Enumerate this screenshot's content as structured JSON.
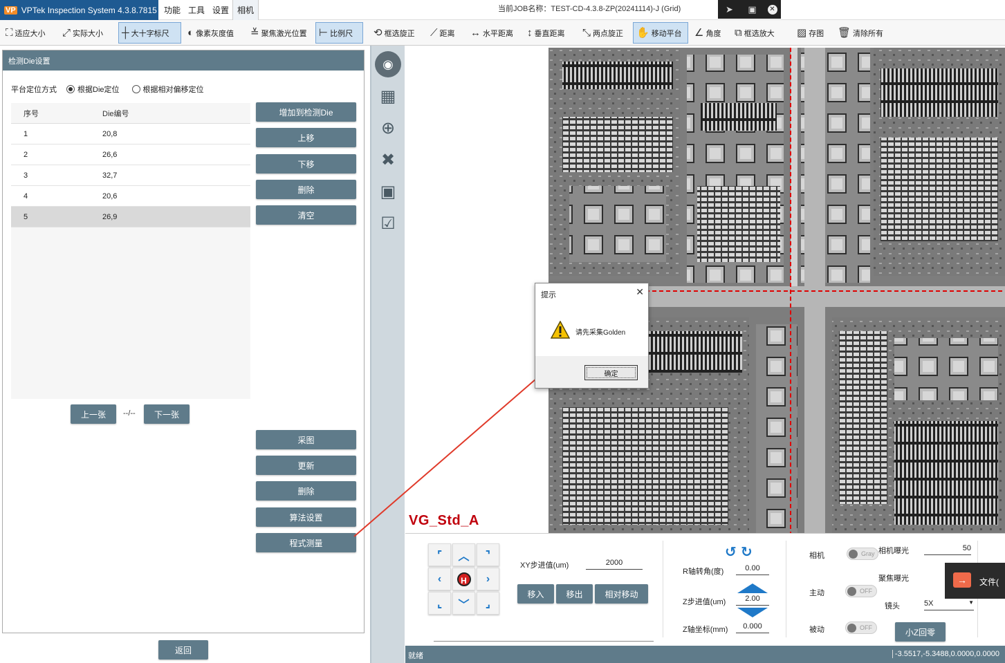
{
  "titlebar": {
    "app_title": "VPTek Inspection System 4.3.8.7815",
    "logo_text": "VP",
    "menu": [
      "功能",
      "工具",
      "设置",
      "相机"
    ],
    "job_name": "当前JOB名称：TEST-CD-4.3.8-ZP(20241114)-J (Grid)"
  },
  "toolbar": {
    "fit_size": "适应大小",
    "actual_size": "实际大小",
    "cross_ruler": "大十字标尺",
    "pixel_gray": "像素灰度值",
    "focus_laser": "聚焦激光位置",
    "scale_ruler": "比例尺",
    "box_rotate": "框选旋正",
    "distance": "距离",
    "h_distance": "水平距离",
    "v_distance": "垂直距离",
    "two_point_rotate": "两点旋正",
    "move_stage": "移动平台",
    "angle": "角度",
    "box_zoom": "框选放大",
    "save_image": "存图",
    "clear_all": "清除所有"
  },
  "left_panel": {
    "header": "检测Die设置",
    "mode_label": "平台定位方式",
    "mode_option_1": "根据Die定位",
    "mode_option_2": "根据相对偏移定位",
    "table_headers": [
      "序号",
      "Die编号"
    ],
    "rows": [
      {
        "idx": "1",
        "die": "20,8"
      },
      {
        "idx": "2",
        "die": "26,6"
      },
      {
        "idx": "3",
        "die": "32,7"
      },
      {
        "idx": "4",
        "die": "20,6"
      },
      {
        "idx": "5",
        "die": "26,9"
      }
    ],
    "buttons": {
      "add": "增加到检测Die",
      "up": "上移",
      "down": "下移",
      "delete": "删除",
      "clear": "清空",
      "prev": "上一张",
      "next": "下一张",
      "capture": "采图",
      "update": "更新",
      "delete2": "删除",
      "algo": "算法设置",
      "measure": "程式测量"
    },
    "pager": "--/--",
    "return": "返回"
  },
  "viewer": {
    "recipe_name": "VG_Std_A"
  },
  "dialog": {
    "title": "提示",
    "message": "请先采集Golden",
    "ok": "确定"
  },
  "controls": {
    "xy_step_label": "XY步进值(um)",
    "xy_step": "2000",
    "move_in": "移入",
    "move_out": "移出",
    "relative_move": "相对移动",
    "r_angle_label": "R轴转角(度)",
    "r_angle": "0.00",
    "z_step_label": "Z步进值(um)",
    "z_step": "2.00",
    "z_coord_label": "Z轴坐标(mm)",
    "z_coord": "0.000",
    "camera_label": "相机",
    "camera_toggle": "Gray",
    "exposure_label": "相机曝光",
    "exposure": "50",
    "focus_exposure_label": "聚焦曝光",
    "active_label": "主动",
    "active_toggle": "OFF",
    "lens_label": "镜头",
    "lens": "5X",
    "passive_label": "被动",
    "passive_toggle": "OFF",
    "z_home": "小Z回零"
  },
  "file_popup": {
    "text": "文件("
  },
  "statusbar": {
    "status": "就绪",
    "coords": "-3.5517,-5.3488,0.0000,0.0000"
  }
}
